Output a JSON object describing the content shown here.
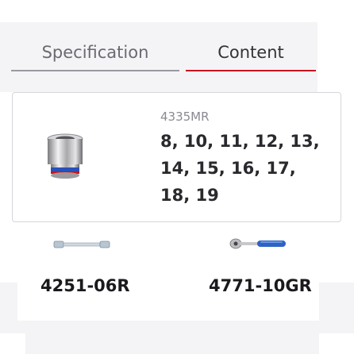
{
  "tabs": [
    {
      "label": "Specification",
      "active": false
    },
    {
      "label": "Content",
      "active": true
    }
  ],
  "accent_color": "#c8141e",
  "card": {
    "model": "4335MR",
    "sizes": "8, 10, 11, 12, 13, 14, 15, 16, 17, 18, 19",
    "icon": "socket-icon"
  },
  "products": [
    {
      "label": "4251-06R",
      "icon": "extension-bar-icon"
    },
    {
      "label": "4771-10GR",
      "icon": "ratchet-handle-icon"
    }
  ]
}
